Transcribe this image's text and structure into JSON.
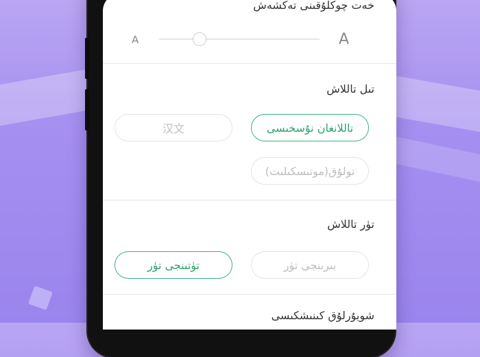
{
  "settings": {
    "font_size": {
      "title": "خەت چوكلۇقىنى تەكشەش",
      "small_label": "A",
      "large_label": "A",
      "level": 0.25
    },
    "language": {
      "title": "تىل تاللاش",
      "options": [
        "تاللانغان نۇسخىسى",
        "汉文",
        "تولۇق(موتىسكىلىت)"
      ],
      "selected": "تاللانغان نۇسخىسى"
    },
    "theme": {
      "title": "تۈر تاللاش",
      "options": [
        "بىرىنجى تۈر",
        "تۈتىنجى تۈر"
      ],
      "selected": "تۈتىنجى تۈر"
    },
    "next_section": {
      "title": "شويۇرلۇق كىنىشكىسى"
    }
  },
  "colors": {
    "accent": "#2ea26f",
    "background": "#a58ff0"
  }
}
